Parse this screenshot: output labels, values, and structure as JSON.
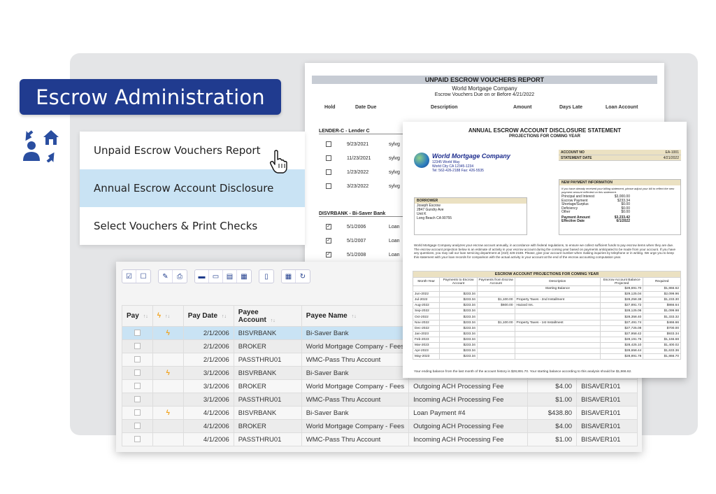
{
  "banner": {
    "title": "Escrow Administration",
    "icon": "person-house-exchange-icon"
  },
  "menu": {
    "items": [
      {
        "label": "Unpaid Escrow Vouchers Report",
        "active": false
      },
      {
        "label": "Annual Escrow Account Disclosure",
        "active": true
      },
      {
        "label": "Select Vouchers & Print Checks",
        "active": false
      }
    ]
  },
  "report": {
    "title": "UNPAID ESCROW VOUCHERS REPORT",
    "company": "World Mortgage Company",
    "subtitle": "Escrow Vouchers Due on or Before 4/21/2022",
    "columns": {
      "hold": "Hold",
      "date_due": "Date Due",
      "description": "Description",
      "amount": "Amount",
      "days_late": "Days Late",
      "loan_account": "Loan Account"
    },
    "groups": [
      {
        "name": "LENDER-C - Lender C",
        "rows": [
          {
            "checked": false,
            "date": "9/23/2021",
            "desc": "sylvg"
          },
          {
            "checked": false,
            "date": "11/23/2021",
            "desc": "sylvg"
          },
          {
            "checked": false,
            "date": "1/23/2022",
            "desc": "sylvg"
          },
          {
            "checked": false,
            "date": "3/23/2022",
            "desc": "sylvg"
          }
        ]
      },
      {
        "name": "DISVRBANK - Bi-Saver Bank",
        "rows": [
          {
            "checked": true,
            "date": "5/1/2006",
            "desc": "Loan"
          },
          {
            "checked": true,
            "date": "5/1/2007",
            "desc": "Loan"
          },
          {
            "checked": true,
            "date": "5/1/2008",
            "desc": "Loan"
          }
        ]
      }
    ]
  },
  "disclosure": {
    "title": "ANNUAL ESCROW ACCOUNT DISCLOSURE STATEMENT",
    "subtitle": "PROJECTIONS FOR COMING YEAR",
    "company": "World Mortgage Company",
    "company_address": [
      "12345 World Way",
      "World City CA 12345-1234",
      "Tel: 562-426-2188  Fax: 426-5535"
    ],
    "account": [
      {
        "label": "ACCOUNT NO",
        "value": "EA-1001"
      },
      {
        "label": "STATEMENT DATE",
        "value": "4/21/2022"
      }
    ],
    "new_payment": {
      "header": "NEW PAYMENT INFORMATION",
      "note": "If you have already received your billing statement, please adjust your bill to reflect the new payment amount reflected on this statement.",
      "rows": [
        {
          "label": "Principal and Interest",
          "value": "$3,000.00"
        },
        {
          "label": "Escrow Payment",
          "value": "$233.34"
        },
        {
          "label": "Shortage/Surplus",
          "value": "$0.00"
        },
        {
          "label": "Deficiency",
          "value": "$0.00"
        },
        {
          "label": "Other",
          "value": "$0.00"
        }
      ],
      "payment_amount_label": "Payment Amount",
      "payment_amount": "$3,233.42",
      "effective_date_label": "Effective Date",
      "effective_date": "6/1/2022"
    },
    "borrower": {
      "header": "BORROWER",
      "lines": [
        "Joseph Escrow",
        "2847 Gundry Ave",
        "Unit K",
        "Long Beach CA 90755"
      ]
    },
    "paragraph": "World Mortgage Company analyzes your escrow account annually, in accordance with federal regulations, to ensure we collect sufficient funds to pay escrow items when they are due. The escrow account projection below is an estimate of activity in your escrow account during the coming year based on payments anticipated to be made from your account. If you have any questions, you may call our loan servicing department at (310) 426-2188. Please, give your account number when making inquiries by telephone or in writing. We urge you to keep this statement with your loan records for comparison with the actual activity in your account at the end of the escrow accounting computation year.",
    "projections": {
      "caption": "ESCROW ACCOUNT PROJECTIONS FOR COMING YEAR",
      "headers": [
        "Month-Year",
        "Payments to Escrow Account",
        "Payments from Escrow Account",
        "Description",
        "Escrow Account Balance Projected",
        "Required"
      ],
      "rows": [
        [
          "",
          "",
          "",
          "Starting Balance",
          "$28,691.70",
          "$1,866.62"
        ],
        [
          "Jun-2022",
          "$233.34",
          "",
          "",
          "$29,125.04",
          "$2,099.96"
        ],
        [
          "Jul-2022",
          "$233.34",
          "$1,100.00",
          "Property Taxes - 2nd Installment",
          "$28,258.38",
          "$1,233.30"
        ],
        [
          "Aug-2022",
          "$233.34",
          "$600.00",
          "Hazard Ins.",
          "$27,891.72",
          "$866.64"
        ],
        [
          "Sep-2022",
          "$233.34",
          "",
          "",
          "$28,125.06",
          "$1,099.98"
        ],
        [
          "Oct-2022",
          "$233.34",
          "",
          "",
          "$28,358.40",
          "$1,333.32"
        ],
        [
          "Nov-2022",
          "$233.34",
          "$1,100.00",
          "Property Taxes - 1st Installment",
          "$27,491.74",
          "$466.66"
        ],
        [
          "Dec-2022",
          "$233.34",
          "",
          "",
          "$27,725.08",
          "$700.00"
        ],
        [
          "Jan-2023",
          "$233.34",
          "",
          "",
          "$27,958.42",
          "$933.34"
        ],
        [
          "Feb-2023",
          "$233.34",
          "",
          "",
          "$28,191.76",
          "$1,166.68"
        ],
        [
          "Mar-2023",
          "$233.34",
          "",
          "",
          "$28,425.10",
          "$1,400.02"
        ],
        [
          "Apr-2023",
          "$233.34",
          "",
          "",
          "$28,658.44",
          "$1,633.36"
        ],
        [
          "May-2023",
          "$233.34",
          "",
          "",
          "$28,891.78",
          "$1,866.70"
        ]
      ]
    },
    "ending": "Your ending balance from the last month of the account history is $28,891.70. Your starting balance according to this analysis should be $1,866.62."
  },
  "grid": {
    "columns": {
      "pay": "Pay",
      "flag": "",
      "pay_date": "Pay Date",
      "payee_account": "Payee Account",
      "payee_name": "Payee Name",
      "description": "",
      "amount": "",
      "loan": ""
    },
    "rows": [
      {
        "flag": true,
        "date": "2/1/2006",
        "account": "BISVRBANK",
        "name": "Bi-Saver Bank",
        "desc": "",
        "amount": "",
        "loan": "",
        "selected": true
      },
      {
        "flag": false,
        "date": "2/1/2006",
        "account": "BROKER",
        "name": "World Mortgage Company - Fees",
        "desc": "",
        "amount": "",
        "loan": ""
      },
      {
        "flag": false,
        "date": "2/1/2006",
        "account": "PASSTHRU01",
        "name": "WMC-Pass Thru Account",
        "desc": "",
        "amount": "",
        "loan": ""
      },
      {
        "flag": true,
        "date": "3/1/2006",
        "account": "BISVRBANK",
        "name": "Bi-Saver Bank",
        "desc": "",
        "amount": "",
        "loan": ""
      },
      {
        "flag": false,
        "date": "3/1/2006",
        "account": "BROKER",
        "name": "World Mortgage Company - Fees",
        "desc": "Outgoing ACH Processing Fee",
        "amount": "$4.00",
        "loan": "BISAVER101"
      },
      {
        "flag": false,
        "date": "3/1/2006",
        "account": "PASSTHRU01",
        "name": "WMC-Pass Thru Account",
        "desc": "Incoming ACH Processing Fee",
        "amount": "$1.00",
        "loan": "BISAVER101"
      },
      {
        "flag": true,
        "date": "4/1/2006",
        "account": "BISVRBANK",
        "name": "Bi-Saver Bank",
        "desc": "Loan Payment #4",
        "amount": "$438.80",
        "loan": "BISAVER101"
      },
      {
        "flag": false,
        "date": "4/1/2006",
        "account": "BROKER",
        "name": "World Mortgage Company - Fees",
        "desc": "Outgoing ACH Processing Fee",
        "amount": "$4.00",
        "loan": "BISAVER101"
      },
      {
        "flag": false,
        "date": "4/1/2006",
        "account": "PASSTHRU01",
        "name": "WMC-Pass Thru Account",
        "desc": "Incoming ACH Processing Fee",
        "amount": "$1.00",
        "loan": "BISAVER101"
      }
    ]
  }
}
